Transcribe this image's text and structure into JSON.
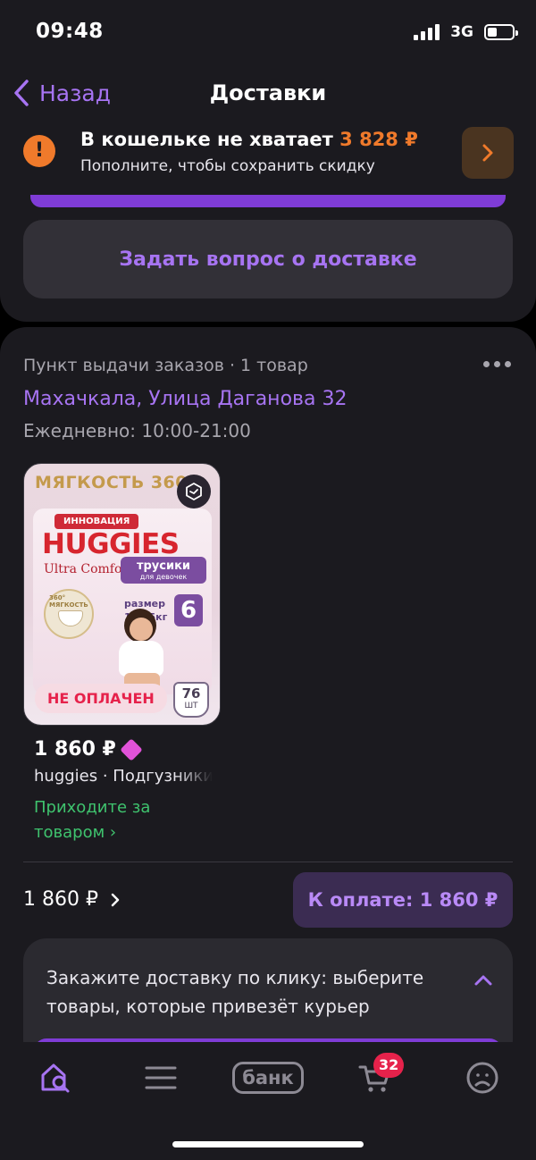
{
  "status": {
    "time": "09:48",
    "network": "3G",
    "battery_level": 0.4
  },
  "nav": {
    "back_label": "Назад",
    "title": "Доставки"
  },
  "wallet": {
    "message": "В кошельке не хватает",
    "amount": "3 828 ₽",
    "subtitle": "Пополните, чтобы сохранить скидку",
    "icon": "exclamation-icon",
    "accent_color": "#f07a2b"
  },
  "ask_button": {
    "label": "Задать вопрос о доставке"
  },
  "order": {
    "pickup_type": "Пункт выдачи заказов · 1 товар",
    "address": "Махачкала, Улица Даганова 32",
    "hours": "Ежедневно: 10:00-21:00",
    "product": {
      "package": {
        "headline": "МЯГКОСТЬ 360°",
        "innovation": "ИННОВАЦИЯ",
        "brand": "HUGGIES",
        "line": "Ultra Comfort",
        "type": "трусики",
        "type_sub": "для девочек",
        "size_label": "размер",
        "size_range": "15-25кг",
        "size_number": "6",
        "softness_note": "360° МЯГКОСТЬ",
        "count": "76",
        "count_unit": "ШТ"
      },
      "status_badge": "НЕ ОПЛАЧЕН",
      "price": "1 860 ₽",
      "name": "huggies · Подгузники",
      "pickup_status": "Приходите за товаром ›"
    },
    "total": "1 860 ₽",
    "pay_button": "К оплате: 1 860 ₽"
  },
  "courier": {
    "text": "Закажите доставку по клику: выберите товары, которые привезёт курьер"
  },
  "tabbar": {
    "bank_label": "банк",
    "cart_count": "32",
    "active_color": "#a774f2",
    "inactive_color": "#8d8a94"
  },
  "colors": {
    "background": "#000000",
    "panel": "#1b1a1f",
    "accent": "#a774f2",
    "success": "#3fc36e",
    "danger": "#e6224b"
  }
}
